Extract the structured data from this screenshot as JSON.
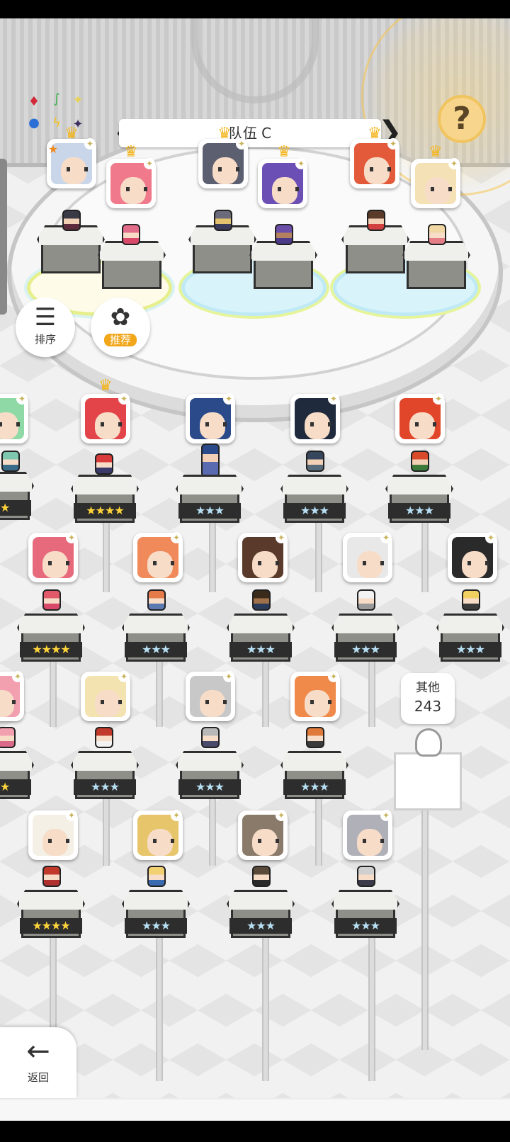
{
  "header": {
    "team_name": "队伍 C",
    "prev_arrow": "❮",
    "next_arrow": "❯",
    "help_label": "?"
  },
  "elements": [
    "♦",
    "♦",
    "♦",
    "♦",
    "★",
    "ϟ"
  ],
  "sort_button": {
    "label": "排序",
    "icon": "sort-icon"
  },
  "recommend_button": {
    "label": "推荐",
    "icon": "flower-icon"
  },
  "others": {
    "label": "其他",
    "count": "243"
  },
  "back_button": {
    "label": "返回",
    "arrow": "←"
  },
  "team_members": [
    {
      "crown": false,
      "star": true
    },
    {
      "crown": true
    },
    {
      "crown": true
    },
    {
      "crown": true
    },
    {
      "crown": true
    },
    {
      "crown": true
    }
  ],
  "roster": {
    "row1": [
      {
        "stars": "★★",
        "rank": "silver"
      },
      {
        "stars": "★★★★",
        "rank": "gold",
        "crown": true
      },
      {
        "stars": "★★★",
        "rank": "silver"
      },
      {
        "stars": "★★★",
        "rank": "silver"
      },
      {
        "stars": "★★★",
        "rank": "silver"
      }
    ],
    "row2": [
      {
        "stars": "★★★★",
        "rank": "gold"
      },
      {
        "stars": "★★★",
        "rank": "silver"
      },
      {
        "stars": "★★★",
        "rank": "silver"
      },
      {
        "stars": "★★★",
        "rank": "silver"
      },
      {
        "stars": "★★★",
        "rank": "silver"
      }
    ],
    "row3": [
      {
        "stars": "★★",
        "rank": "silver"
      },
      {
        "stars": "★★★",
        "rank": "silver"
      },
      {
        "stars": "★★★",
        "rank": "silver"
      },
      {
        "stars": "★★★",
        "rank": "silver"
      }
    ],
    "row4": [
      {
        "stars": "★★★★",
        "rank": "gold"
      },
      {
        "stars": "★★★",
        "rank": "silver"
      },
      {
        "stars": "★★★",
        "rank": "silver"
      },
      {
        "stars": "★★★",
        "rank": "silver"
      }
    ]
  },
  "colors": {
    "gold_star": "#ffd43b",
    "silver_star": "#b7dff3",
    "accent": "#f2a61a"
  }
}
